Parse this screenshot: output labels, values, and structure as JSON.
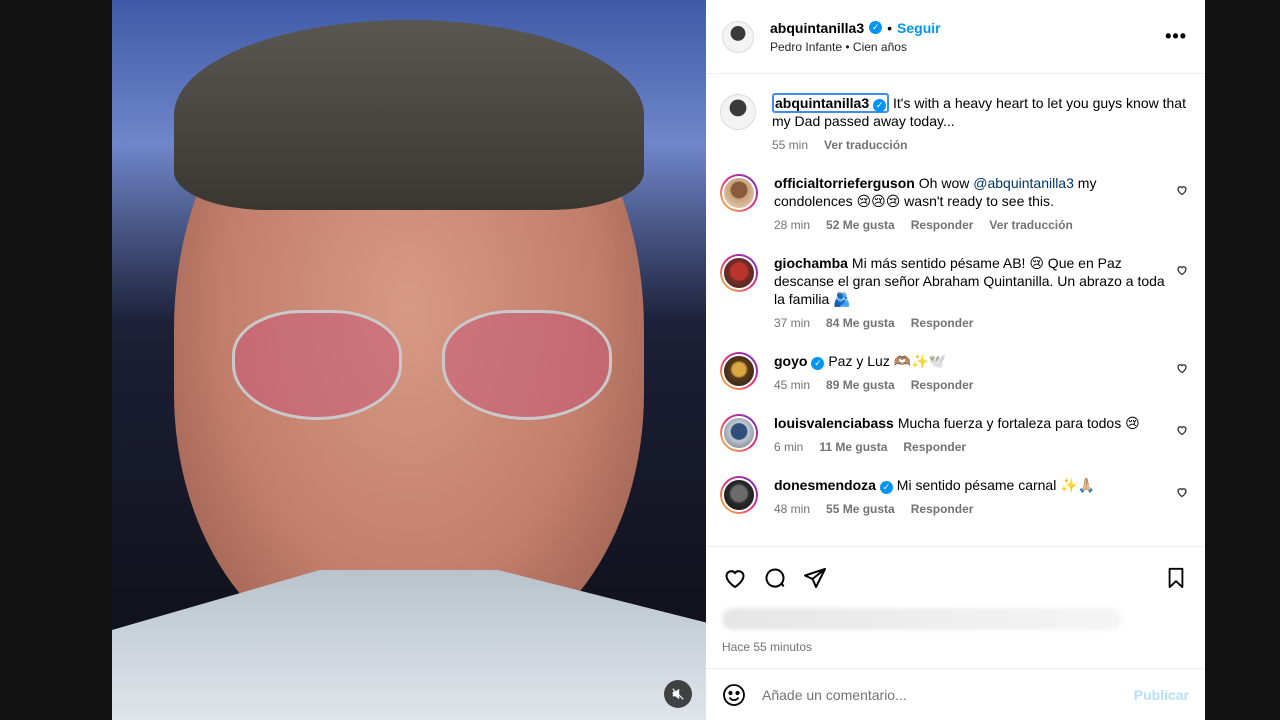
{
  "post": {
    "username": "abquintanilla3",
    "verified": true,
    "separator": "•",
    "follow_label": "Seguir",
    "audio": "Pedro Infante • Cien años",
    "more_label": "•••"
  },
  "caption": {
    "username": "abquintanilla3",
    "text": "It's with a heavy heart to let you guys know that my Dad passed away today...",
    "time": "55 min",
    "translate": "Ver traducción"
  },
  "comments": [
    {
      "username": "officialtorrieferguson",
      "verified": false,
      "text_pre": "Oh wow ",
      "mention": "@abquintanilla3",
      "text_post": " my condolences 😢😢😢 wasn't ready to see this.",
      "time": "28 min",
      "likes": "52 Me gusta",
      "reply": "Responder",
      "translate": "Ver traducción"
    },
    {
      "username": "giochamba",
      "verified": false,
      "text": "Mi más sentido pésame AB! 😢 Que en Paz descanse el gran señor Abraham Quintanilla. Un abrazo a toda la familia 🫂",
      "time": "37 min",
      "likes": "84 Me gusta",
      "reply": "Responder"
    },
    {
      "username": "goyo",
      "verified": true,
      "text": "Paz y Luz 🫶🏽✨🕊️",
      "time": "45 min",
      "likes": "89 Me gusta",
      "reply": "Responder"
    },
    {
      "username": "louisvalenciabass",
      "verified": false,
      "text": "Mucha fuerza y fortaleza para todos 😢",
      "time": "6 min",
      "likes": "11 Me gusta",
      "reply": "Responder"
    },
    {
      "username": "donesmendoza",
      "verified": true,
      "text": "Mi sentido pésame carnal ✨🙏🏼",
      "time": "48 min",
      "likes": "55 Me gusta",
      "reply": "Responder"
    }
  ],
  "footer": {
    "time_ago": "Hace 55 minutos",
    "comment_placeholder": "Añade un comentario...",
    "post_label": "Publicar"
  },
  "icons": {
    "verified": "verified-badge-icon",
    "heart": "heart-icon",
    "comment": "comment-icon",
    "share": "share-icon",
    "save": "bookmark-icon",
    "emoji": "emoji-icon",
    "mute": "mute-icon",
    "more": "more-options-icon"
  },
  "colors": {
    "accent": "#0095f6",
    "verified": "#0095f6",
    "mention": "#00376b",
    "muted_text": "#737373",
    "publish_disabled": "#b2dffc"
  }
}
